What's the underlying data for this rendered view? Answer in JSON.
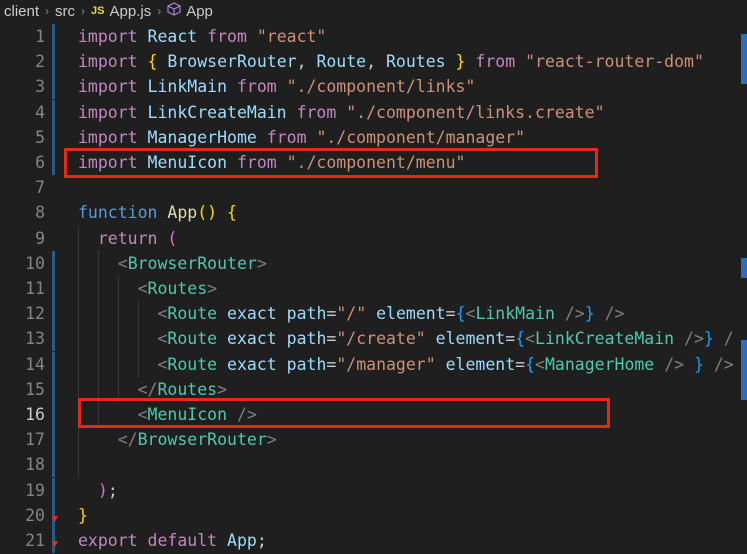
{
  "breadcrumb": {
    "folder1": "client",
    "folder2": "src",
    "file_badge": "JS",
    "file": "App.js",
    "symbol": "App"
  },
  "lines": [
    {
      "n": "1",
      "tokens": [
        [
          "kw",
          "import "
        ],
        [
          "var",
          "React "
        ],
        [
          "kw",
          "from "
        ],
        [
          "str",
          "\"react\""
        ]
      ]
    },
    {
      "n": "2",
      "tokens": [
        [
          "kw",
          "import "
        ],
        [
          "brace",
          "{ "
        ],
        [
          "var",
          "BrowserRouter"
        ],
        [
          "punc",
          ", "
        ],
        [
          "var",
          "Route"
        ],
        [
          "punc",
          ", "
        ],
        [
          "var",
          "Routes "
        ],
        [
          "brace",
          "} "
        ],
        [
          "kw",
          "from "
        ],
        [
          "str",
          "\"react-router-dom\""
        ]
      ]
    },
    {
      "n": "3",
      "tokens": [
        [
          "kw",
          "import "
        ],
        [
          "var",
          "LinkMain "
        ],
        [
          "kw",
          "from "
        ],
        [
          "str",
          "\"./component/links\""
        ]
      ]
    },
    {
      "n": "4",
      "tokens": [
        [
          "kw",
          "import "
        ],
        [
          "var",
          "LinkCreateMain "
        ],
        [
          "kw",
          "from "
        ],
        [
          "str",
          "\"./component/links.create\""
        ]
      ]
    },
    {
      "n": "5",
      "tokens": [
        [
          "kw",
          "import "
        ],
        [
          "var",
          "ManagerHome "
        ],
        [
          "kw",
          "from "
        ],
        [
          "str",
          "\"./component/manager\""
        ]
      ]
    },
    {
      "n": "6",
      "tokens": [
        [
          "kw",
          "import "
        ],
        [
          "var",
          "MenuIcon "
        ],
        [
          "kw",
          "from "
        ],
        [
          "str",
          "\"./component/menu\""
        ]
      ]
    },
    {
      "n": "7",
      "tokens": []
    },
    {
      "n": "8",
      "tokens": [
        [
          "kw2",
          "function "
        ],
        [
          "fn",
          "App"
        ],
        [
          "brace",
          "() {"
        ]
      ]
    },
    {
      "n": "9",
      "tokens": [
        [
          "punc",
          "  "
        ],
        [
          "kw",
          "return "
        ],
        [
          "brace2",
          "("
        ]
      ]
    },
    {
      "n": "10",
      "tokens": [
        [
          "punc",
          "    "
        ],
        [
          "tag",
          "<"
        ],
        [
          "cls",
          "BrowserRouter"
        ],
        [
          "tag",
          ">"
        ]
      ]
    },
    {
      "n": "11",
      "tokens": [
        [
          "punc",
          "      "
        ],
        [
          "tag",
          "<"
        ],
        [
          "cls",
          "Routes"
        ],
        [
          "tag",
          ">"
        ]
      ]
    },
    {
      "n": "12",
      "tokens": [
        [
          "punc",
          "        "
        ],
        [
          "tag",
          "<"
        ],
        [
          "cls",
          "Route "
        ],
        [
          "attr",
          "exact "
        ],
        [
          "attr",
          "path"
        ],
        [
          "punc",
          "="
        ],
        [
          "str",
          "\"/\" "
        ],
        [
          "attr",
          "element"
        ],
        [
          "punc",
          "="
        ],
        [
          "brace3",
          "{"
        ],
        [
          "tag",
          "<"
        ],
        [
          "cls",
          "LinkMain "
        ],
        [
          "tag",
          "/>"
        ],
        [
          "brace3",
          "} "
        ],
        [
          "tag",
          "/>"
        ]
      ]
    },
    {
      "n": "13",
      "tokens": [
        [
          "punc",
          "        "
        ],
        [
          "tag",
          "<"
        ],
        [
          "cls",
          "Route "
        ],
        [
          "attr",
          "exact "
        ],
        [
          "attr",
          "path"
        ],
        [
          "punc",
          "="
        ],
        [
          "str",
          "\"/create\" "
        ],
        [
          "attr",
          "element"
        ],
        [
          "punc",
          "="
        ],
        [
          "brace3",
          "{"
        ],
        [
          "tag",
          "<"
        ],
        [
          "cls",
          "LinkCreateMain "
        ],
        [
          "tag",
          "/>"
        ],
        [
          "brace3",
          "} "
        ],
        [
          "tag",
          "/"
        ]
      ]
    },
    {
      "n": "14",
      "tokens": [
        [
          "punc",
          "        "
        ],
        [
          "tag",
          "<"
        ],
        [
          "cls",
          "Route "
        ],
        [
          "attr",
          "exact "
        ],
        [
          "attr",
          "path"
        ],
        [
          "punc",
          "="
        ],
        [
          "str",
          "\"/manager\" "
        ],
        [
          "attr",
          "element"
        ],
        [
          "punc",
          "="
        ],
        [
          "brace3",
          "{"
        ],
        [
          "tag",
          "<"
        ],
        [
          "cls",
          "ManagerHome "
        ],
        [
          "tag",
          "/> "
        ],
        [
          "brace3",
          "} "
        ],
        [
          "tag",
          "/>"
        ]
      ]
    },
    {
      "n": "15",
      "tokens": [
        [
          "punc",
          "      "
        ],
        [
          "tag",
          "</"
        ],
        [
          "cls",
          "Routes"
        ],
        [
          "tag",
          ">"
        ]
      ]
    },
    {
      "n": "16",
      "tokens": [
        [
          "punc",
          "      "
        ],
        [
          "tag",
          "<"
        ],
        [
          "cls",
          "MenuIcon "
        ],
        [
          "tag",
          "/>"
        ]
      ]
    },
    {
      "n": "17",
      "tokens": [
        [
          "punc",
          "    "
        ],
        [
          "tag",
          "</"
        ],
        [
          "cls",
          "BrowserRouter"
        ],
        [
          "tag",
          ">"
        ]
      ]
    },
    {
      "n": "18",
      "tokens": []
    },
    {
      "n": "19",
      "tokens": [
        [
          "punc",
          "  "
        ],
        [
          "brace2",
          ")"
        ],
        [
          "punc",
          ";"
        ]
      ]
    },
    {
      "n": "20",
      "tokens": [
        [
          "brace",
          "}"
        ]
      ]
    },
    {
      "n": "21",
      "tokens": [
        [
          "kw",
          "export "
        ],
        [
          "kw",
          "default "
        ],
        [
          "var",
          "App"
        ],
        [
          "punc",
          ";"
        ]
      ]
    }
  ],
  "active_line": "16",
  "colors": {
    "highlight": "#e8281a",
    "keyword": "#c586c0",
    "string": "#ce9178",
    "component": "#4ec9b0"
  }
}
